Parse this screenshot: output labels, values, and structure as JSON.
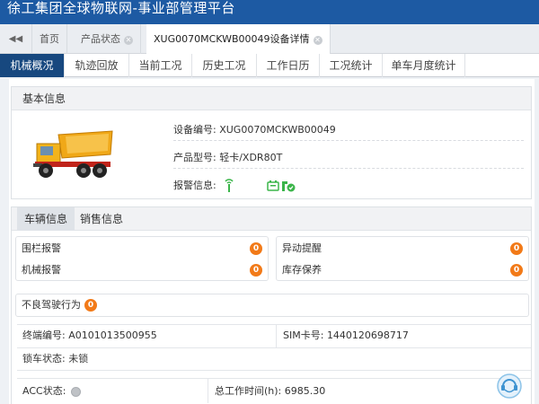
{
  "app": {
    "title": "徐工集团全球物联网-事业部管理平台"
  },
  "tabs": [
    {
      "label": "首页"
    },
    {
      "label": "产品状态"
    },
    {
      "label": "XUG0070MCKWB00049设备详情"
    }
  ],
  "subtabs": [
    {
      "label": "机械概况"
    },
    {
      "label": "轨迹回放"
    },
    {
      "label": "当前工况"
    },
    {
      "label": "历史工况"
    },
    {
      "label": "工作日历"
    },
    {
      "label": "工况统计"
    },
    {
      "label": "单车月度统计"
    }
  ],
  "basic_info": {
    "heading": "基本信息",
    "device_no_label": "设备编号:",
    "device_no": "XUG0070MCKWB00049",
    "model_label": "产品型号:",
    "model": "轻卡/XDR80T",
    "alarm_label": "报警信息:"
  },
  "vehicle": {
    "tabs": [
      {
        "label": "车辆信息"
      },
      {
        "label": "销售信息"
      }
    ],
    "stats": [
      {
        "label": "围栏报警",
        "count": "0"
      },
      {
        "label": "异动提醒",
        "count": "0"
      },
      {
        "label": "机械报警",
        "count": "0"
      },
      {
        "label": "库存保养",
        "count": "0"
      }
    ],
    "bad_driving": {
      "label": "不良驾驶行为",
      "count": "0"
    },
    "terminal_label": "终端编号:",
    "terminal_no": "A0101013500955",
    "sim_label": "SIM卡号:",
    "sim_no": "1440120698717",
    "lock_label": "锁车状态:",
    "lock_status": "未锁",
    "acc_label": "ACC状态:",
    "work_time_label": "总工作时间(h):",
    "work_time": "6985.30"
  },
  "colors": {
    "header_blue": "#1d5aa3",
    "active_subtab": "#17487f",
    "badge_orange": "#f27a18",
    "alarm_green": "#3bb54a"
  },
  "icons": {
    "back": "double-chevron-left-icon",
    "close": "close-icon",
    "truck": "dump-truck-image",
    "alarm": [
      "signal-antenna-icon",
      "battery-icon",
      "key-check-icon"
    ],
    "acc": "acc-off-dot-icon",
    "help": "customer-service-icon"
  }
}
